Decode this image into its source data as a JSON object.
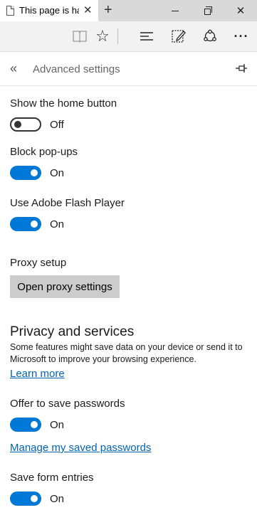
{
  "browser": {
    "tab_title": "This page is ha",
    "tab_close_glyph": "✕",
    "new_tab_glyph": "+",
    "close_glyph": "✕"
  },
  "toolbar": {
    "icons": [
      "reading-view-icon",
      "favorites-star-icon",
      "hub-icon",
      "web-note-icon",
      "share-icon",
      "more-icon"
    ],
    "more_glyph": "···",
    "star_glyph": "☆"
  },
  "panel": {
    "back_glyph": "«",
    "title": "Advanced settings"
  },
  "settings": {
    "home_button": {
      "label": "Show the home button",
      "state": "Off"
    },
    "popups": {
      "label": "Block pop-ups",
      "state": "On"
    },
    "flash": {
      "label": "Use Adobe Flash Player",
      "state": "On"
    },
    "proxy": {
      "label": "Proxy setup",
      "button": "Open proxy settings"
    },
    "privacy": {
      "title": "Privacy and services",
      "description": "Some features might save data on your device or send it to Microsoft to improve your browsing experience.",
      "learn_more": "Learn more"
    },
    "passwords": {
      "label": "Offer to save passwords",
      "state": "On",
      "manage_link": "Manage my saved passwords"
    },
    "form_entries": {
      "label": "Save form entries",
      "state": "On"
    }
  },
  "colors": {
    "accent": "#0078d7",
    "link": "#0063b1",
    "titlebar": "#d9d9d9",
    "toolbar": "#f2f2f2",
    "button": "#cccccc"
  }
}
